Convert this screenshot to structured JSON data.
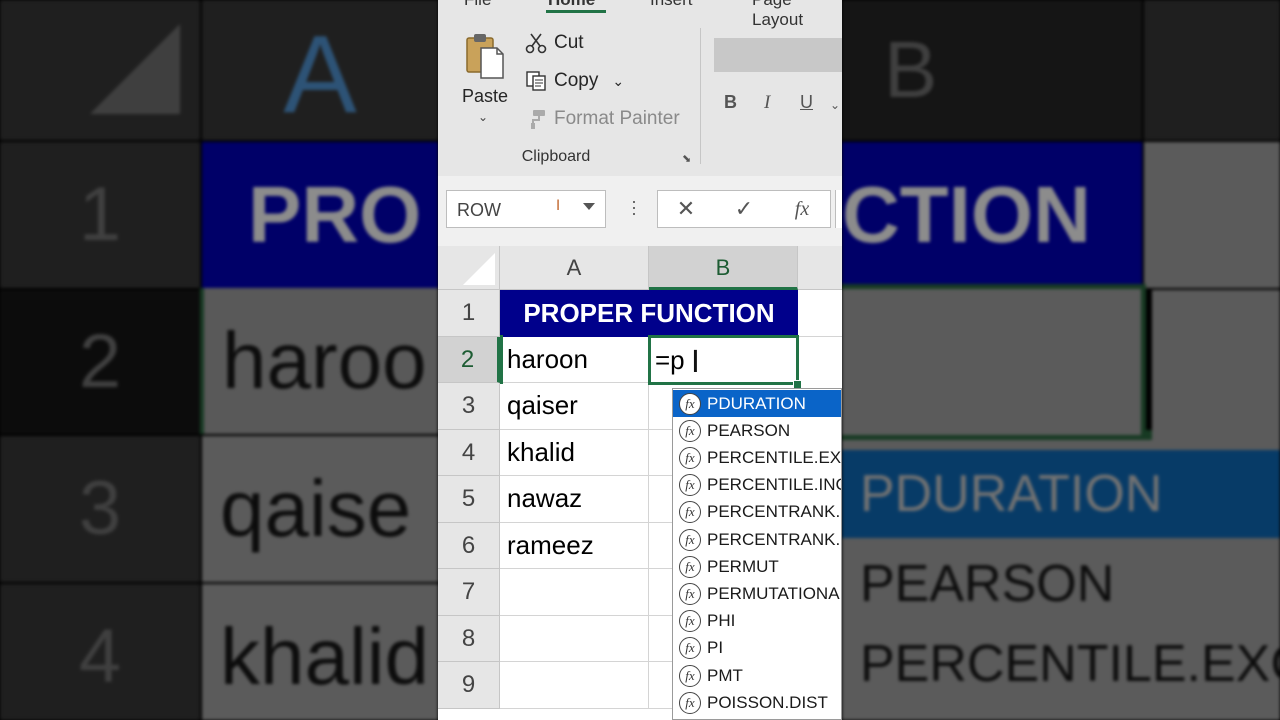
{
  "ribbon": {
    "tabs": [
      "File",
      "Home",
      "Insert",
      "Page Layout"
    ],
    "paste_label": "Paste",
    "cut_label": "Cut",
    "copy_label": "Copy",
    "format_painter_label": "Format Painter",
    "clipboard_group_label": "Clipboard",
    "bold_label": "B",
    "italic_label": "I",
    "underline_label": "U"
  },
  "formula_bar": {
    "name_box": "ROW",
    "cancel_symbol": "✕",
    "enter_symbol": "✓",
    "fx_symbol": "fx"
  },
  "sheet": {
    "columns": [
      "A",
      "B"
    ],
    "rows": [
      "1",
      "2",
      "3",
      "4",
      "5",
      "6",
      "7",
      "8",
      "9"
    ],
    "title": "PROPER FUNCTION",
    "names": [
      "haroon",
      "qaiser",
      "khalid",
      "nawaz",
      "rameez"
    ],
    "active_cell_input": "=p",
    "active_cell_ref": "B2"
  },
  "autocomplete": {
    "items": [
      "PDURATION",
      "PEARSON",
      "PERCENTILE.EXC",
      "PERCENTILE.INC",
      "PERCENTRANK.EXC",
      "PERCENTRANK.INC",
      "PERMUT",
      "PERMUTATIONA",
      "PHI",
      "PI",
      "PMT",
      "POISSON.DIST"
    ],
    "selected_index": 0
  },
  "background": {
    "left_col_letter": "A",
    "left_rows": [
      "1",
      "2",
      "3",
      "4"
    ],
    "left_title": "PRO",
    "left_cells": [
      "haroo",
      "qaise",
      "khalid"
    ],
    "right_col_letter": "B",
    "right_title": "CTION",
    "right_items": [
      "PDURATION",
      "PEARSON",
      "PERCENTILE.EXC"
    ]
  },
  "colors": {
    "excel_green": "#217346",
    "title_fill": "#00008B",
    "selection_blue": "#0A64C8"
  }
}
